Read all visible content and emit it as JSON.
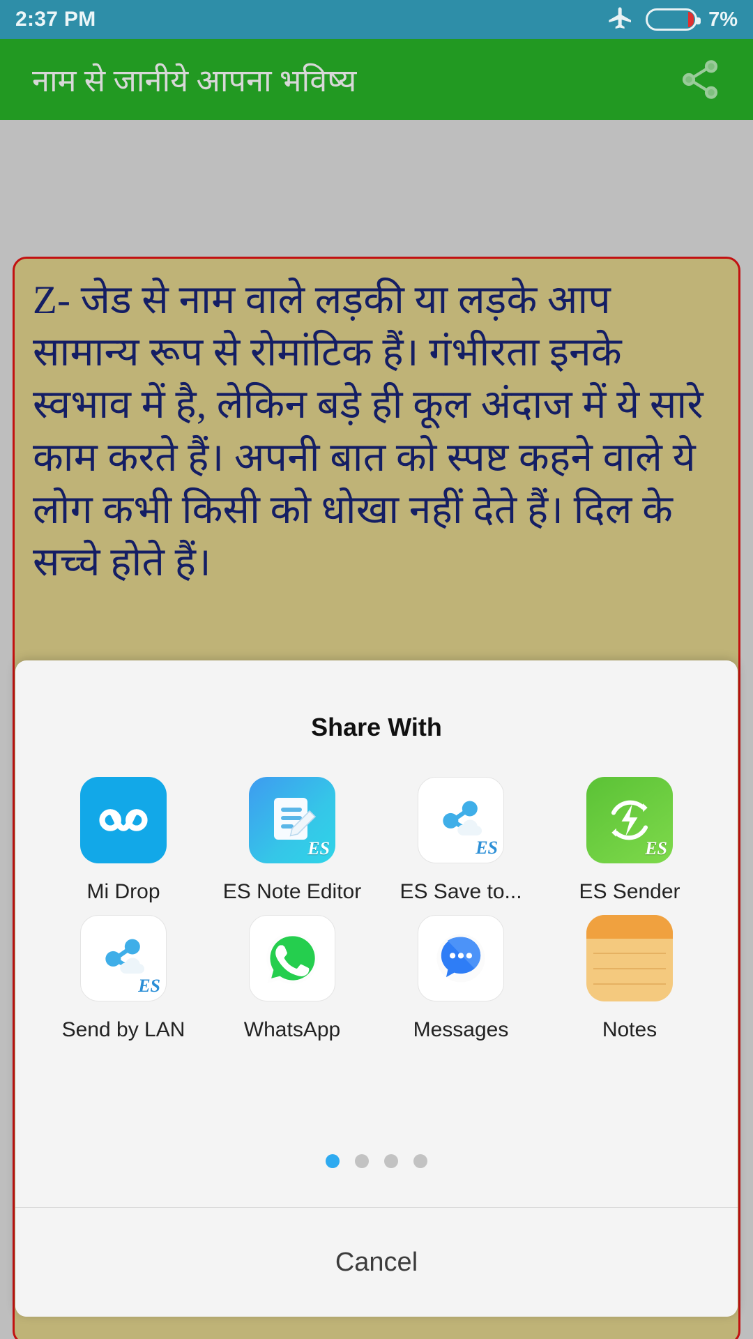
{
  "status_bar": {
    "time": "2:37 PM",
    "battery_percent": "7%",
    "airplane_icon": "airplane-mode-icon",
    "battery_icon": "battery-icon",
    "background_color": "#2E8EA8"
  },
  "app_bar": {
    "title": "नाम से जानीये आपना भविष्य",
    "share_icon": "share-icon",
    "background_color": "#229922"
  },
  "content": {
    "fortune_text": "Z- जेड से नाम वाले लड़की या लड़के आप सामान्य रूप से रोमांटिक हैं। गंभीरता इनके स्वभाव में है, लेकिन बड़े ही कूल अंदाज में ये सारे काम करते हैं। अपनी बात को स्पष्ट कहने वाले ये लोग कभी किसी को धोखा नहीं देते हैं। दिल के सच्चे होते हैं।",
    "card_background_color": "#BFB377",
    "card_border_color": "#C21111",
    "text_color": "#141E64"
  },
  "share_sheet": {
    "title": "Share With",
    "cancel_label": "Cancel",
    "rows": [
      [
        {
          "label": "Mi Drop",
          "icon": "mi-drop-icon"
        },
        {
          "label": "ES Note Editor",
          "icon": "es-note-editor-icon"
        },
        {
          "label": "ES Save to...",
          "icon": "es-save-to-icon"
        },
        {
          "label": "ES Sender",
          "icon": "es-sender-icon"
        }
      ],
      [
        {
          "label": "Send by LAN",
          "icon": "send-by-lan-icon"
        },
        {
          "label": "WhatsApp",
          "icon": "whatsapp-icon"
        },
        {
          "label": "Messages",
          "icon": "messages-icon"
        },
        {
          "label": "Notes",
          "icon": "notes-icon"
        }
      ]
    ],
    "page_dots": {
      "total": 4,
      "active_index": 0,
      "active_color": "#2EAAF0"
    }
  }
}
